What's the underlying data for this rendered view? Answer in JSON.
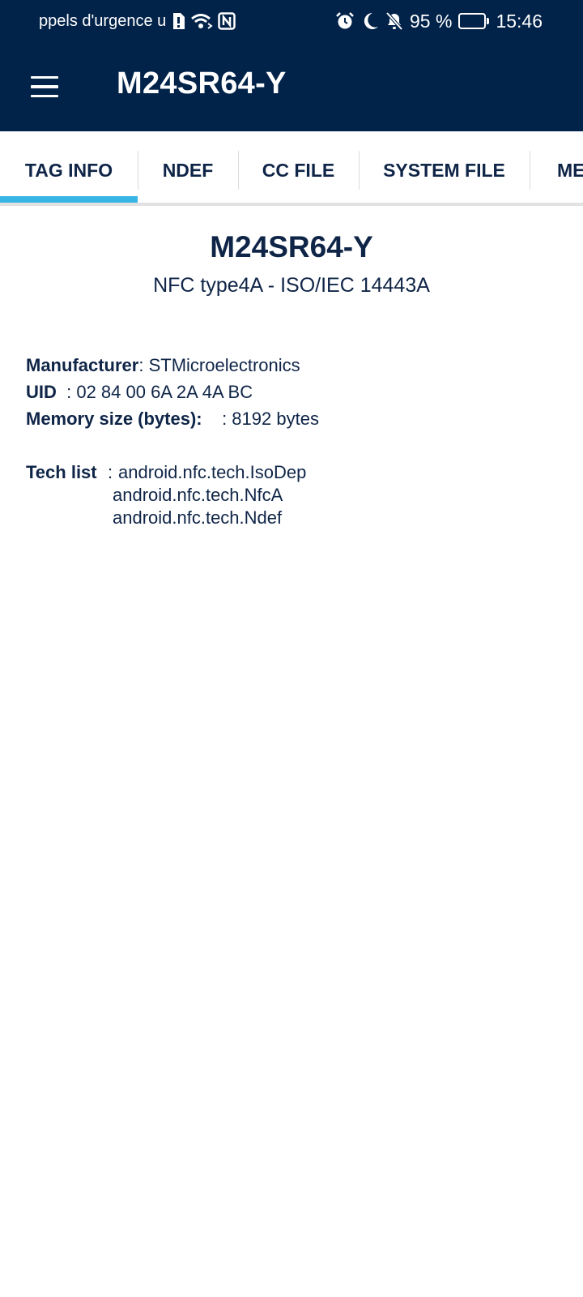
{
  "status_bar": {
    "carrier_text": "ppels d'urgence u",
    "battery_percent": "95 %",
    "time": "15:46",
    "battery_level": 0.95,
    "icons": [
      "sim-alert-icon",
      "wifi-icon",
      "nfc-icon",
      "alarm-icon",
      "moon-icon",
      "bell-off-icon",
      "battery-icon"
    ]
  },
  "app_bar": {
    "title": "M24SR64-Y",
    "menu_icon": "hamburger-menu-icon"
  },
  "tabs": [
    {
      "label": "TAG INFO",
      "active": true
    },
    {
      "label": "NDEF",
      "active": false
    },
    {
      "label": "CC FILE",
      "active": false
    },
    {
      "label": "SYSTEM FILE",
      "active": false
    },
    {
      "label": "ME",
      "active": false
    }
  ],
  "tag": {
    "name": "M24SR64-Y",
    "type": "NFC type4A - ISO/IEC 14443A",
    "manufacturer_label": "Manufacturer",
    "manufacturer_value": ": STMicroelectronics",
    "uid_label": "UID",
    "uid_value": ": 02 84 00 6A 2A 4A BC",
    "memory_label": "Memory size (bytes):",
    "memory_value": ": 8192 bytes",
    "tech_list_label": "Tech list",
    "tech_list_sep": ":",
    "tech_list": [
      "android.nfc.tech.IsoDep",
      "android.nfc.tech.NfcA",
      "android.nfc.tech.Ndef"
    ]
  },
  "colors": {
    "header_bg": "#012249",
    "accent": "#37b6e3",
    "text": "#0f2547"
  }
}
